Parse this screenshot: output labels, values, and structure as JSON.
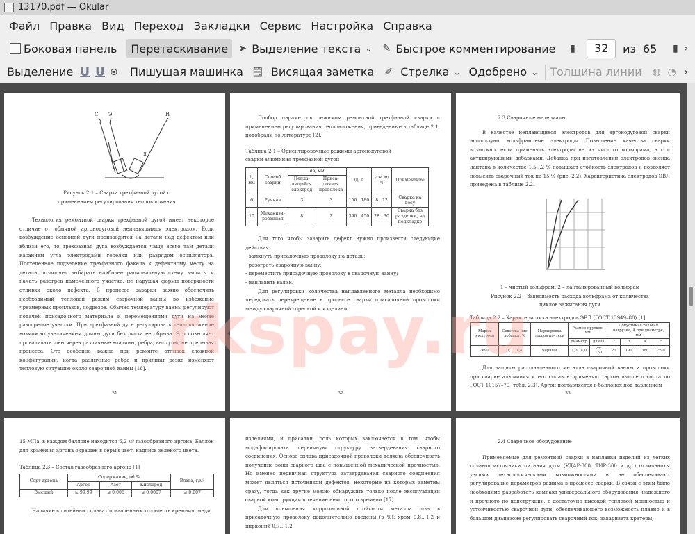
{
  "window": {
    "title": "13170.pdf  — Okular"
  },
  "menu": [
    "Файл",
    "Правка",
    "Вид",
    "Переход",
    "Закладки",
    "Сервис",
    "Настройка",
    "Справка"
  ],
  "toolbar1": {
    "sidebar": "Боковая панель",
    "drag": "Перетаскивание",
    "text_select": "Выделение текста",
    "quick_comment": "Быстрое комментирование",
    "page_value": "32",
    "of_label": "из",
    "total_pages": "65"
  },
  "toolbar2": {
    "highlight": "Выделение",
    "typewriter": "Пишущая машинка",
    "popup_note": "Висящая заметка",
    "arrow": "Стрелка",
    "approved": "Одобрено",
    "line_width": "Толщина линии"
  },
  "watermark": "rkspay.ru",
  "pages": {
    "p1": {
      "figure_labels": [
        "С",
        "Э",
        "И",
        "Д"
      ],
      "caption": "Рисунок 2.1 – Сварка трехфазной дугой с применением регулирования тепловложения",
      "body": "Технология ремонтной сварки трехфазной дугой имеет некоторое отличие от обычной аргонодуговой неплавящимся электродом. Если возбуждение основной дуги производится на детали над дефектом или вблизи его, то трехфазная дуга возбуждается чаще всего там детали касанием угла электродами горелки или разрядом осциллятора. Постепенное подведение трехфазного факела к дефектному месту на детали позволяет выбирать наиболее рациональную схему защиты и начать разогрев намеченного участка, не нарушая формы поверхности отливки около дефекта. В процессе заварки важно обеспечить необходимый тепловой режим сварочной ванны во избежание чрезмерных проплавов, подрезов. Обычно температуру ванны регулируют подачей присадочного материала и перемещениями дуги на менее разогретые участки. При трехфазной дуге регулировать тепловложение возможно увеличением длины дуги без риска ее обрыва. Это позволяет проваливать швы через различные впадины, ребра, выступы, не прерывая процесса. Это особенно важно при ремонте отливок сложной конфигурации, когда различные ребра и приливы резко изменяют тепловую ситуацию около сварочной ванны [16].",
      "page_number": "31"
    },
    "p2": {
      "intro": "Подбор параметров режимом ремонтной трехфазной сварки с применением регулирования тепловложения, приведенные в таблице 2.1, подобрали по литературе [2].",
      "table_title": "Таблица 2.1 – Ориентировочные режимы аргонодуговой сварки алюминия трехфазной дугой",
      "table_header": [
        "b, мм",
        "Способ сварки",
        "Непла-вящийся электрод",
        "Приса-дочная проволока",
        "Iд, А",
        "vсв, м/ч",
        "Примечание"
      ],
      "table_group": "dэ, мм",
      "table_rows": [
        [
          "6",
          "Ручная",
          "3",
          "3",
          "150...180",
          "8...12",
          "Сварка на весу"
        ],
        [
          "10",
          "Механизи-рованная",
          "8",
          "2",
          "390...450",
          "28...30",
          "Сварка без разделки, на подкладке"
        ]
      ],
      "list_intro": "Для того чтобы заварить дефект нужно произвести следующие действия:",
      "list_items": [
        "- замкнуть присадочную проволоку на деталь;",
        "- разогреть сварочную ванну;",
        "- переместить присадочную проволоку в сварочную ванну;",
        "- наплавить валик."
      ],
      "outro": "Для регулировки количества наплавленного металла необходимо чередовать перекрещение в процессе сварки присадочной проволоки между сварочной горелкой и изделием.",
      "page_number": "32"
    },
    "p3": {
      "heading": "2.3 Сварочные материалы",
      "body1": "В качестве неплавящихся электродов для аргонодуговой сварки используют вольфрамовые электроды. Повышение качества сварки возможно, если применять электроды не из чистого вольфрама, а с с активирующими добавками. Добавка при изготовлении электродов оксида лантана в количестве 1,5…2 % повышает стойкость электродов и позволяет повысить сварочный ток на 15 % (рис. 2.2). Характеристика электродов ЭВЛ приведена в таблице 2.2.",
      "graph_legend": "1 – чистый вольфрам; 2 – лантанированный вольфрам",
      "caption": "Рисунок 2.2 – Зависимость расхода вольфрама от количества циклов зажигания дуги",
      "table_title": "Таблица 2.2 – Характеристика электродов ЭВЛ (ГОСТ 13949–80) [1]",
      "table_header": [
        "Марка электрода",
        "Содержа-ние добавки, %",
        "Маркировка торцов прутков",
        "Размер прутков, мм",
        "Допустимая токовая нагрузка, А при диаметре, мм"
      ],
      "table_sub": [
        "диаметр",
        "длина",
        "2",
        "3",
        "4",
        "5"
      ],
      "table_row": [
        "ЭВЛ",
        "1,1…1,4",
        "Черный",
        "1,0…4,0",
        "75; 150",
        "20",
        "190",
        "380",
        "590"
      ],
      "body2": "Для защиты расплавленного металла сварочной ванны и проволоки при сварке алюминия и его сплавов применяют аргон высшего сорта по ГОСТ 10157–79 (табл. 2.3). Аргон поставляется в баллонах под давлением",
      "page_number": "33"
    },
    "p4": {
      "body1": "15 МПа, в каждом баллоне находится 6,2 м³ газообразного аргона. Баллон для хранения аргона окрашен в серый цвет, надпись зеленого цвета.",
      "table_title": "Таблица 2.3 – Состав газообразного аргона [1]",
      "table_header": [
        "Сорт аргона",
        "Содержание, об %",
        "Влага, г/м³"
      ],
      "table_sub": [
        "Аргон",
        "Азот",
        "Кислород"
      ],
      "table_row": [
        "Высший",
        "≥ 99,99",
        "≤ 0,006",
        "≤ 0,0007",
        "≤ 0,007"
      ],
      "body2": "Наличие в литейных сплавах повышенных количеств кремния, меди,"
    },
    "p5": {
      "body": "изделиями, и присадки, роль которых заключается в том, чтобы модифицировать первичную структуру затвердевания сварного соединения. Основа сплава присадочной проволоки должна обеспечивать получение зоны сварного шва с повышенной механической прочностью. Но именно первичная структура затвердевания сварного соединения может являться источником дефектов, некоторые из которых заметны сразу, тогда как другие можно обнаружить только после эксплуатации сварной конструкции в течение некоторого времени [17].",
      "body2": "Для повышения коррозионной стойкости металла шва в присадочную проволоку дополнительно введены (в %): хром 0,8…1,2 и цирконий 0,7…1,2"
    },
    "p6": {
      "heading": "2.4 Сварочное оборудование",
      "body": "Применяемые для ремонтной сварки в наплавки изделий из легких сплавов источники питания дуги (УДАР-300, ТИР-300 и др.) отличаются узкими технологическими возможностями и не обеспечивают регулирование параметров режима в процессе сварки. В связи с этим было необходимо разработать компакт универсального оборудования, надежного и прочного по конструкции, с достаточно высокой тепловой мощностью и устойчивостью сварочной дуги, обеспечивающего возможность плавно и в большом диапазоне регулировать сварочный ток, заваривать кратеры,"
    }
  }
}
